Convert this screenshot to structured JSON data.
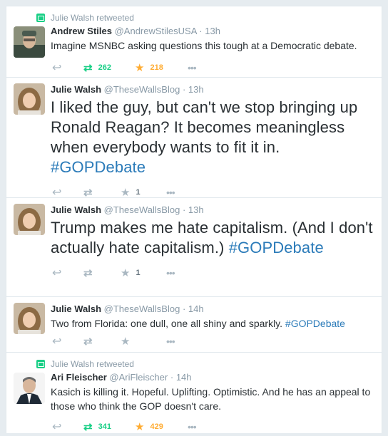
{
  "tweets": [
    {
      "context": "Julie Walsh retweeted",
      "fullname": "Andrew Stiles",
      "username": "@AndrewStilesUSA",
      "dot": "·",
      "time": "13h",
      "text": "Imagine MSNBC asking questions this tough at a Democratic debate.",
      "retweets": "262",
      "favorites": "218"
    },
    {
      "fullname": "Julie Walsh",
      "username": "@TheseWallsBlog",
      "dot": "·",
      "time": "13h",
      "text": "I liked the guy, but can't we stop bringing up Ronald Reagan? It becomes meaningless when everybody wants to fit it in.",
      "hashtag": "#GOPDebate",
      "favorites": "1"
    },
    {
      "fullname": "Julie Walsh",
      "username": "@TheseWallsBlog",
      "dot": "·",
      "time": "13h",
      "text": "Trump makes me hate capitalism. (And I don't actually hate capitalism.)",
      "hashtag": "#GOPDebate",
      "favorites": "1"
    },
    {
      "fullname": "Julie Walsh",
      "username": "@TheseWallsBlog",
      "dot": "·",
      "time": "14h",
      "text": "Two from Florida: one dull, one all shiny and sparkly.",
      "hashtag": "#GOPDebate"
    },
    {
      "context": "Julie Walsh retweeted",
      "fullname": "Ari Fleischer",
      "username": "@AriFleischer",
      "dot": "·",
      "time": "14h",
      "text": "Kasich is killing it.  Hopeful. Uplifting. Optimistic. And he has an appeal to those who think the GOP doesn't care.",
      "retweets": "341",
      "favorites": "429"
    }
  ],
  "icons": {
    "reply": "reply-icon",
    "retweet": "retweet-icon",
    "favorite": "star-icon",
    "more": "more-icon"
  },
  "colors": {
    "retweet_active": "#19cf86",
    "favorite_active": "#ffac33",
    "hashtag": "#2b7bb9",
    "muted": "#8899a6"
  }
}
